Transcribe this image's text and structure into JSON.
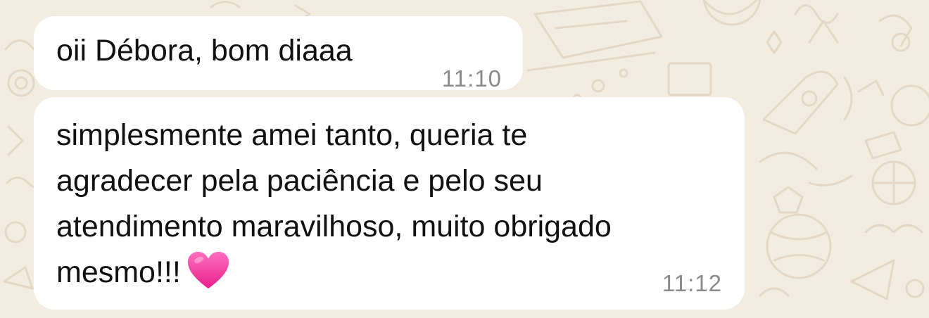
{
  "chat": {
    "messages": [
      {
        "text": "oii Débora, bom diaaa",
        "time": "11:10"
      },
      {
        "lines": [
          "simplesmente amei tanto, queria te",
          "agradecer pela paciência e pelo seu",
          "atendimento maravilhoso, muito obrigado",
          "mesmo!!!"
        ],
        "emoji": "pink-heart-icon",
        "time": "11:12"
      }
    ]
  },
  "colors": {
    "wallpaper": "#f3ece1",
    "doodle": "#e6dccd",
    "bubble": "#ffffff",
    "text": "#111111",
    "timestamp": "#8a8a8a",
    "heart": "#f0309a"
  }
}
